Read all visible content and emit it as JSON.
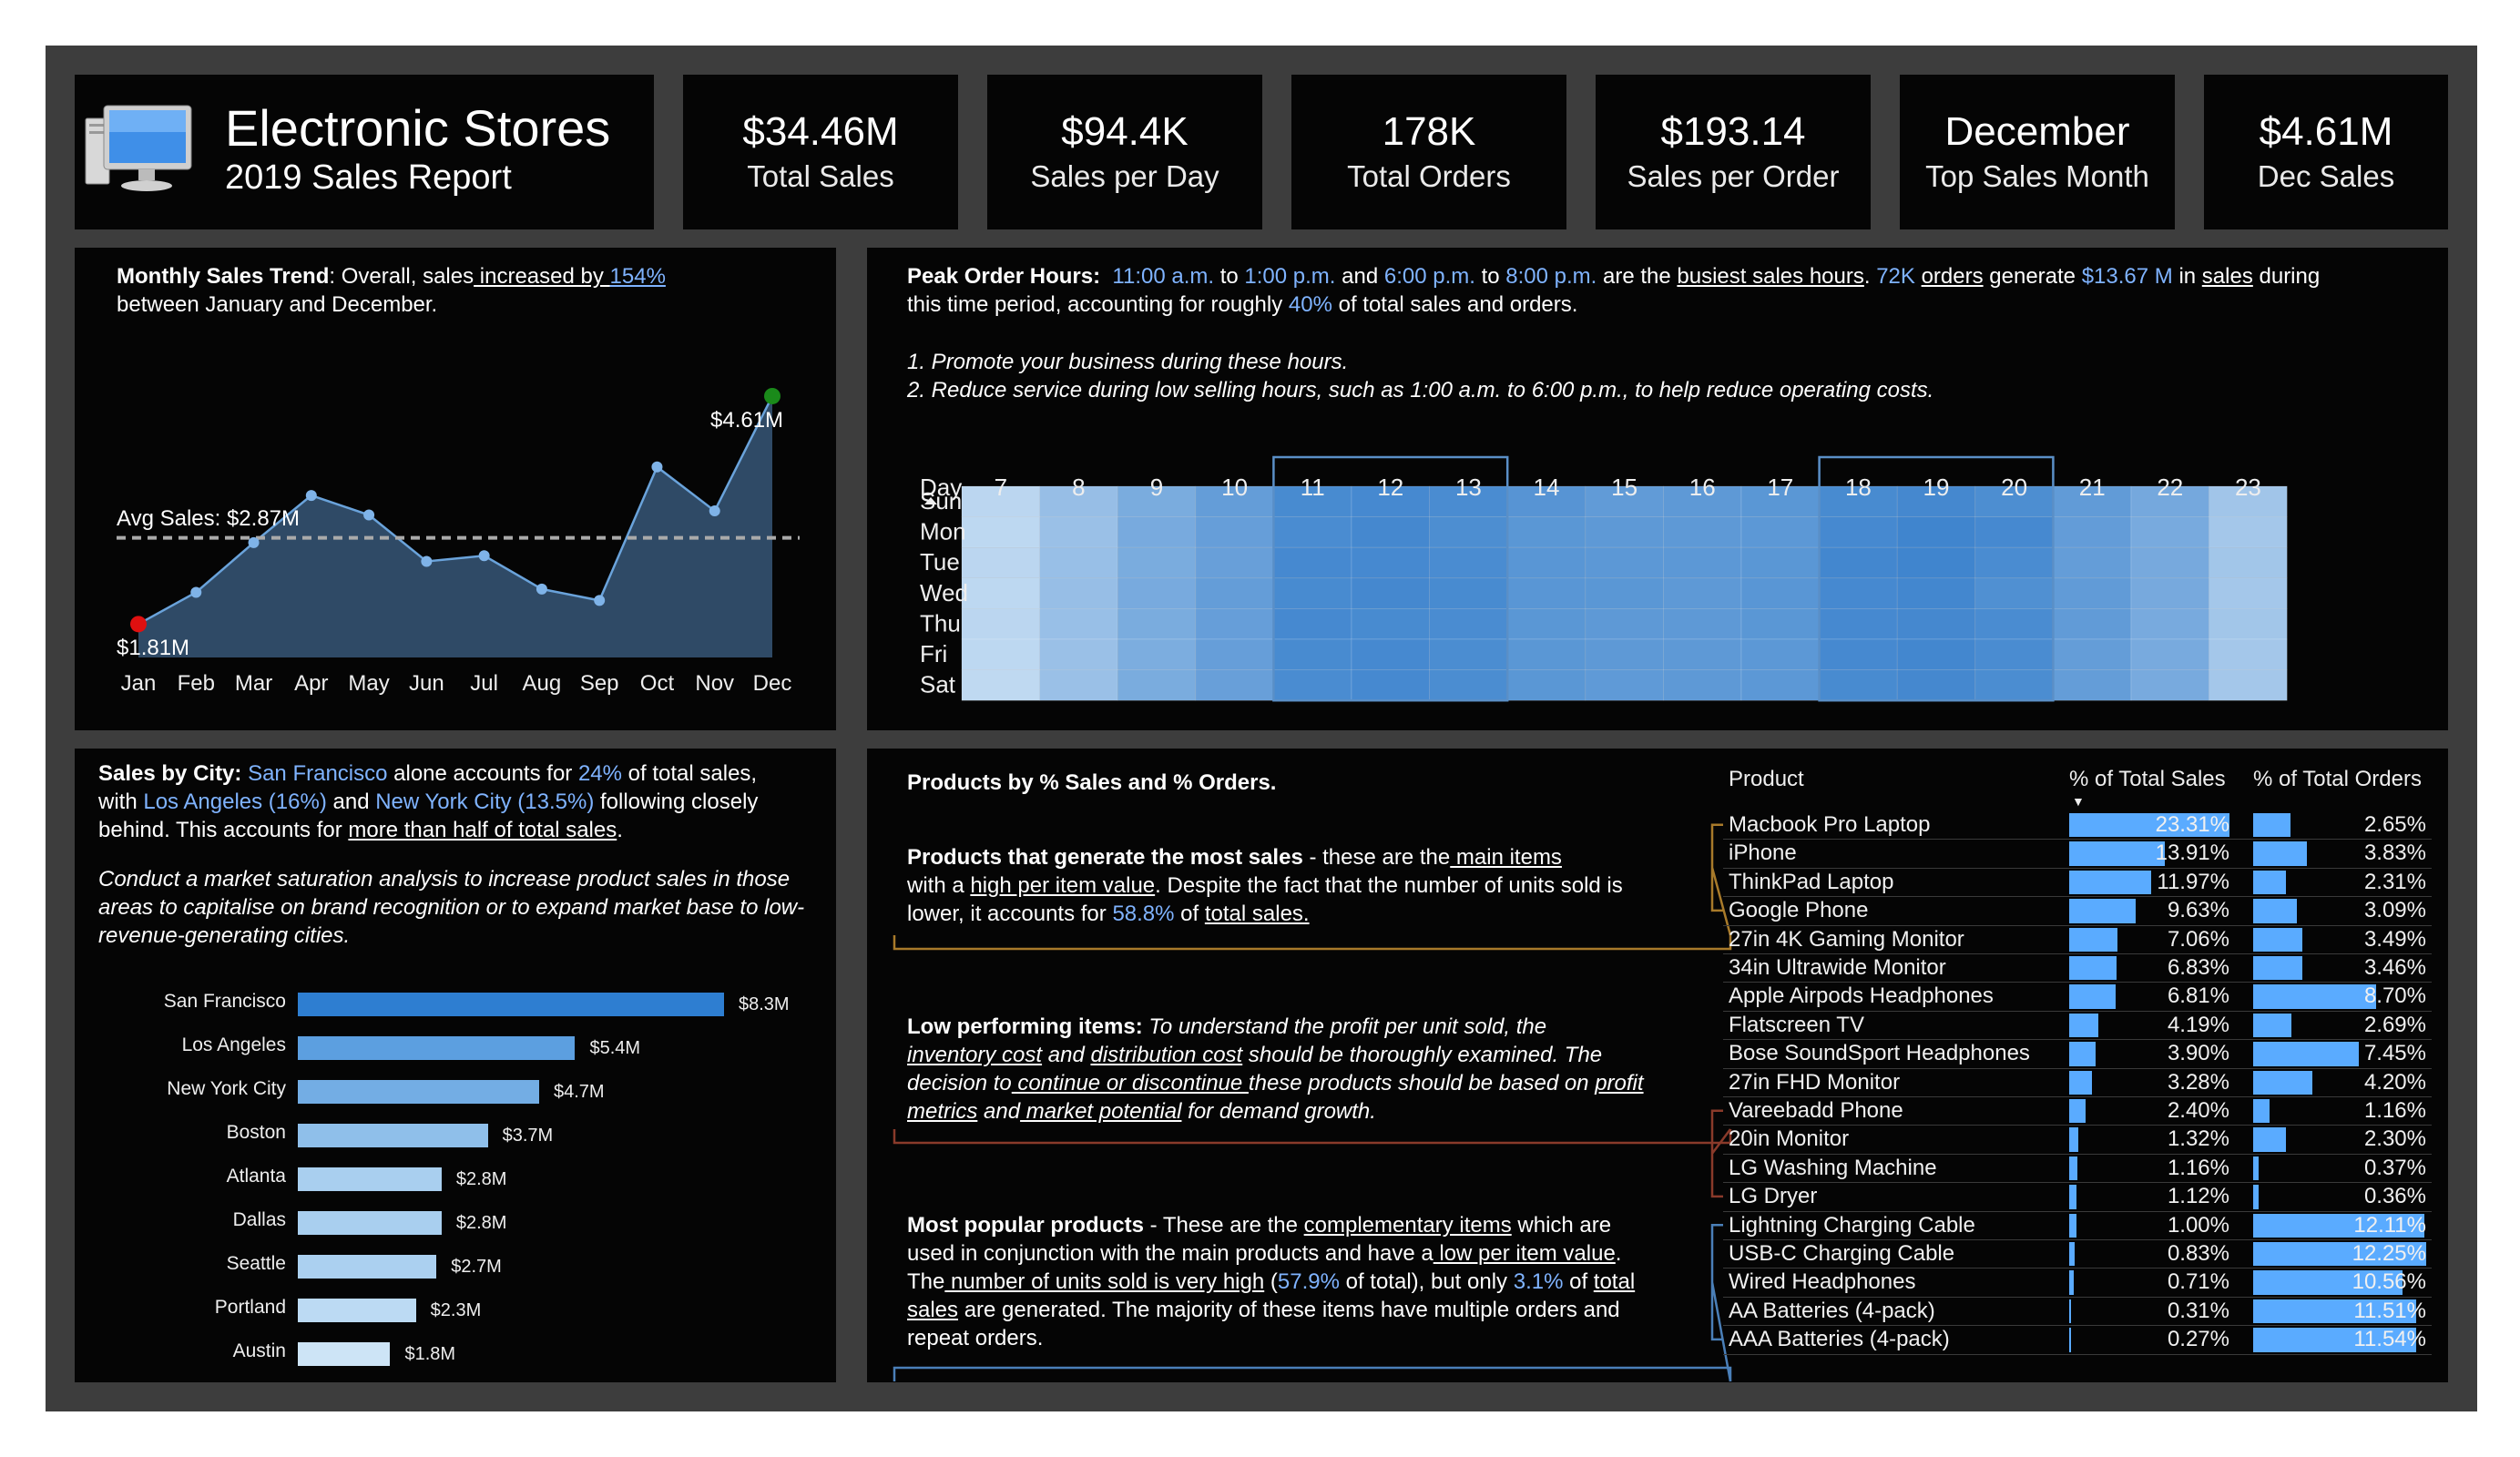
{
  "header": {
    "title": "Electronic Stores",
    "subtitle": "2019 Sales Report",
    "icon": "desktop-computer-icon"
  },
  "kpis": [
    {
      "value": "$34.46M",
      "label": "Total Sales"
    },
    {
      "value": "$94.4K",
      "label": "Sales per Day"
    },
    {
      "value": "178K",
      "label": "Total Orders"
    },
    {
      "value": "$193.14",
      "label": "Sales per Order"
    },
    {
      "value": "December",
      "label": "Top Sales Month"
    },
    {
      "value": "$4.61M",
      "label": "Dec Sales"
    }
  ],
  "trend": {
    "title": "Monthly Sales Trend",
    "text_a": ": Overall, sales",
    "text_b": " increased by ",
    "text_c": "154% ",
    "text_d": "between January and December.",
    "avg_label": "Avg Sales: $2.87M",
    "max_label": "$4.61M",
    "min_label": "$1.81M"
  },
  "peak": {
    "title": "Peak Order Hours:",
    "t1": "11:00 a.m.",
    "t2": " to ",
    "t3": "1:00 p.m.",
    "t4": " and ",
    "t5": "6:00 p.m.",
    "t6": " to ",
    "t7": "8:00 p.m.",
    "t8": " are the ",
    "t9": "busiest sales hours",
    "t10": ". ",
    "t11": "72K",
    "t12": " ",
    "t13": "orders",
    "t14": " generate ",
    "t15": "$13.67 M",
    "t16": " in ",
    "t17": "sales",
    "t18": " during",
    "t19": "this time period, accounting for roughly ",
    "t20": "40%",
    "t21": " of total sales and orders.",
    "rec1": "1. Promote your business during these hours.",
    "rec2": "2. Reduce service during low selling hours, such as 1:00 a.m. to 6:00 p.m., to help reduce operating costs.",
    "day_header": "Day"
  },
  "city": {
    "title": "Sales by City:",
    "a": " ",
    "sf": "San Francisco",
    "b": " alone accounts for ",
    "p24": "24%",
    "c": " of total sales,",
    "d": "with ",
    "la": "Los Angeles (16%)",
    "e": " and ",
    "ny": "New York City (13.5%)",
    "f": " following closely",
    "g": "behind. This accounts for ",
    "h": "more than half of total sales",
    "i": ".",
    "italic": "Conduct a market saturation analysis to increase product sales in those areas to capitalise on brand recognition or to expand market base to low-revenue-generating cities."
  },
  "products": {
    "title": "Products by % Sales and % Orders.",
    "s1_title": "Products that generate the most sales",
    "s1_a": " - these are the",
    "s1_b": " main items",
    "s1_c": "with a ",
    "s1_d": "high per item value",
    "s1_e": ". Despite the fact that the number of units sold is",
    "s1_f": "lower, it accounts for ",
    "s1_g": "58.8%",
    "s1_h": " of ",
    "s1_i": "total sales.",
    "s2_title": "Low performing items:",
    "s2_a": " To understand the profit per unit sold, the",
    "s2_b": "inventory cost",
    "s2_c": " and ",
    "s2_d": "distribution cost",
    "s2_e": " should be thoroughly examined. The",
    "s2_f": "decision to",
    "s2_g": " continue or discontinue ",
    "s2_h": "these products should be based on ",
    "s2_i": "profit",
    "s2_j": "metrics",
    "s2_k": " and",
    "s2_l": " market potential",
    "s2_m": " for demand growth.",
    "s3_title": "Most popular products",
    "s3_a": " - These are the ",
    "s3_b": "complementary items",
    "s3_c": " which are",
    "s3_d": "used in conjunction with the main products and have a",
    "s3_e": " low per item value",
    "s3_f": ".",
    "s3_g": "The",
    "s3_h": " number of units sold is very high",
    "s3_i": " (",
    "s3_j": "57.9%",
    "s3_k": " of total), but only ",
    "s3_l": "3.1%",
    "s3_m": " of ",
    "s3_n": "total",
    "s3_o": "sales",
    "s3_p": " are generated. The majority of these items have multiple orders and",
    "s3_q": "repeat orders.",
    "col_product": "Product",
    "col_sales": "% of Total Sales",
    "col_orders": "% of Total Orders"
  },
  "chart_data": [
    {
      "type": "area",
      "categories": [
        "Jan",
        "Feb",
        "Mar",
        "Apr",
        "May",
        "Jun",
        "Jul",
        "Aug",
        "Sep",
        "Oct",
        "Nov",
        "Dec"
      ],
      "values": [
        1.81,
        2.2,
        2.81,
        3.39,
        3.15,
        2.58,
        2.65,
        2.24,
        2.1,
        3.74,
        3.2,
        4.61
      ],
      "average": 2.87,
      "unit": "$M",
      "grid": false
    },
    {
      "type": "heatmap",
      "x": [
        "7",
        "8",
        "9",
        "10",
        "11",
        "12",
        "13",
        "14",
        "15",
        "16",
        "17",
        "18",
        "19",
        "20",
        "21",
        "22",
        "23"
      ],
      "y": [
        "Sun",
        "Mon",
        "Tue",
        "Wed",
        "Thu",
        "Fri",
        "Sat"
      ],
      "highlight_ranges": [
        [
          "11",
          "13"
        ],
        [
          "18",
          "20"
        ]
      ],
      "values": [
        [
          0.16,
          0.38,
          0.55,
          0.68,
          0.85,
          0.86,
          0.84,
          0.76,
          0.7,
          0.72,
          0.74,
          0.85,
          0.87,
          0.82,
          0.7,
          0.58,
          0.32
        ],
        [
          0.15,
          0.36,
          0.56,
          0.67,
          0.84,
          0.87,
          0.82,
          0.74,
          0.72,
          0.72,
          0.73,
          0.86,
          0.9,
          0.86,
          0.69,
          0.56,
          0.3
        ],
        [
          0.16,
          0.37,
          0.55,
          0.66,
          0.86,
          0.86,
          0.84,
          0.75,
          0.73,
          0.73,
          0.74,
          0.88,
          0.9,
          0.84,
          0.68,
          0.57,
          0.31
        ],
        [
          0.15,
          0.38,
          0.56,
          0.68,
          0.85,
          0.87,
          0.85,
          0.75,
          0.74,
          0.72,
          0.75,
          0.86,
          0.88,
          0.8,
          0.7,
          0.57,
          0.3
        ],
        [
          0.16,
          0.37,
          0.55,
          0.67,
          0.86,
          0.85,
          0.84,
          0.74,
          0.72,
          0.72,
          0.74,
          0.86,
          0.87,
          0.84,
          0.7,
          0.56,
          0.31
        ],
        [
          0.15,
          0.36,
          0.54,
          0.67,
          0.85,
          0.86,
          0.83,
          0.74,
          0.72,
          0.72,
          0.73,
          0.86,
          0.88,
          0.84,
          0.68,
          0.56,
          0.3
        ],
        [
          0.14,
          0.36,
          0.55,
          0.66,
          0.84,
          0.86,
          0.83,
          0.74,
          0.71,
          0.72,
          0.73,
          0.85,
          0.87,
          0.83,
          0.68,
          0.56,
          0.3
        ]
      ]
    },
    {
      "type": "bar",
      "orientation": "horizontal",
      "categories": [
        "San Francisco",
        "Los Angeles",
        "New York City",
        "Boston",
        "Atlanta",
        "Dallas",
        "Seattle",
        "Portland",
        "Austin"
      ],
      "values": [
        8.3,
        5.4,
        4.7,
        3.7,
        2.8,
        2.8,
        2.7,
        2.3,
        1.8
      ],
      "labels": [
        "$8.3M",
        "$5.4M",
        "$4.7M",
        "$3.7M",
        "$2.8M",
        "$2.8M",
        "$2.7M",
        "$2.3M",
        "$1.8M"
      ],
      "colors": [
        "#2e7ed1",
        "#5c9fe0",
        "#73ade4",
        "#8fbfea",
        "#a9cfef",
        "#a9cfef",
        "#abd0f0",
        "#bcdaf3",
        "#cde4f6"
      ]
    },
    {
      "type": "table",
      "columns": [
        "Product",
        "% of Total Sales",
        "% of Total Orders"
      ],
      "rows": [
        [
          "Macbook Pro Laptop",
          23.31,
          2.65
        ],
        [
          "iPhone",
          13.91,
          3.83
        ],
        [
          "ThinkPad Laptop",
          11.97,
          2.31
        ],
        [
          "Google Phone",
          9.63,
          3.09
        ],
        [
          "27in 4K Gaming Monitor",
          7.06,
          3.49
        ],
        [
          "34in Ultrawide Monitor",
          6.83,
          3.46
        ],
        [
          "Apple Airpods Headphones",
          6.81,
          8.7
        ],
        [
          "Flatscreen TV",
          4.19,
          2.69
        ],
        [
          "Bose SoundSport Headphones",
          3.9,
          7.45
        ],
        [
          "27in FHD Monitor",
          3.28,
          4.2
        ],
        [
          "Vareebadd Phone",
          2.4,
          1.16
        ],
        [
          "20in Monitor",
          1.32,
          2.3
        ],
        [
          "LG Washing Machine",
          1.16,
          0.37
        ],
        [
          "LG Dryer",
          1.12,
          0.36
        ],
        [
          "Lightning Charging Cable",
          1.0,
          12.11
        ],
        [
          "USB-C Charging Cable",
          0.83,
          12.25
        ],
        [
          "Wired Headphones",
          0.71,
          10.56
        ],
        [
          "AA Batteries (4-pack)",
          0.31,
          11.51
        ],
        [
          "AAA Batteries (4-pack)",
          0.27,
          11.54
        ]
      ],
      "sales_labels": [
        "23.31%",
        "13.91%",
        "11.97%",
        "9.63%",
        "7.06%",
        "6.83%",
        "6.81%",
        "4.19%",
        "3.90%",
        "3.28%",
        "2.40%",
        "1.32%",
        "1.16%",
        "1.12%",
        "1.00%",
        "0.83%",
        "0.71%",
        "0.31%",
        "0.27%"
      ],
      "orders_labels": [
        "2.65%",
        "3.83%",
        "2.31%",
        "3.09%",
        "3.49%",
        "3.46%",
        "8.70%",
        "2.69%",
        "7.45%",
        "4.20%",
        "1.16%",
        "2.30%",
        "0.37%",
        "0.36%",
        "12.11%",
        "12.25%",
        "10.56%",
        "11.51%",
        "11.54%"
      ]
    }
  ],
  "colors": {
    "background": "#3d3d3d",
    "panel": "#050505",
    "accent": "#7fb3ff",
    "bar": "#5aabff",
    "high_sales_bracket": "#a87a2a",
    "low_bracket": "#8a3a2a",
    "popular_bracket": "#4a7fb8"
  }
}
